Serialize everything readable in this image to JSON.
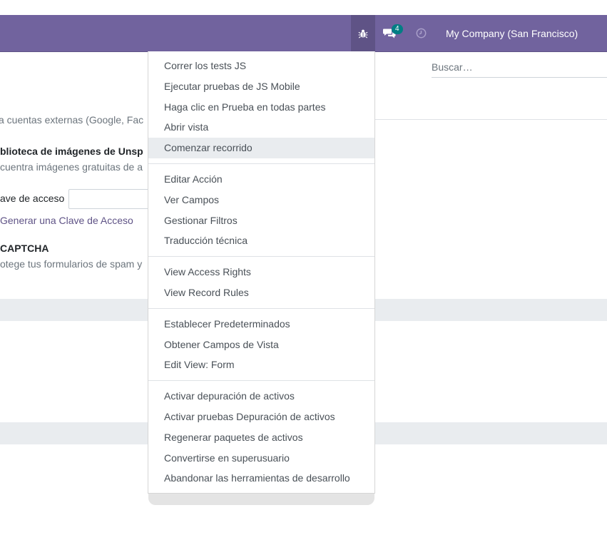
{
  "navbar": {
    "chat_count": "4",
    "company": "My Company (San Francisco)"
  },
  "search": {
    "placeholder": "Buscar…"
  },
  "settings": {
    "external_accounts_text": "a cuentas externas (Google, Fac",
    "unsplash_title": "blioteca de imágenes de Unsp",
    "unsplash_desc": "cuentra imágenes gratuitas de a",
    "access_key_label": "ave de acceso",
    "generate_key_link": "Generar una Clave de Acceso",
    "recaptcha_title": "CAPTCHA",
    "recaptcha_desc": "otege tus formularios de spam y"
  },
  "debug_menu": {
    "groups": [
      [
        "Correr los tests JS",
        "Ejecutar pruebas de JS Mobile",
        "Haga clic en Prueba en todas partes",
        "Abrir vista",
        "Comenzar recorrido"
      ],
      [
        "Editar Acción",
        "Ver Campos",
        "Gestionar Filtros",
        "Traducción técnica"
      ],
      [
        "View Access Rights",
        "View Record Rules"
      ],
      [
        "Establecer Predeterminados",
        "Obtener Campos de Vista",
        "Edit View: Form"
      ],
      [
        "Activar depuración de activos",
        "Activar pruebas Depuración de activos",
        "Regenerar paquetes de activos",
        "Convertirse en superusuario",
        "Abandonar las herramientas de desarrollo"
      ]
    ],
    "highlighted": "Comenzar recorrido"
  },
  "colors": {
    "navbar": "#71639e",
    "navbar_active": "#5f5386",
    "badge": "#017e84",
    "highlight": "#e9ecef"
  }
}
